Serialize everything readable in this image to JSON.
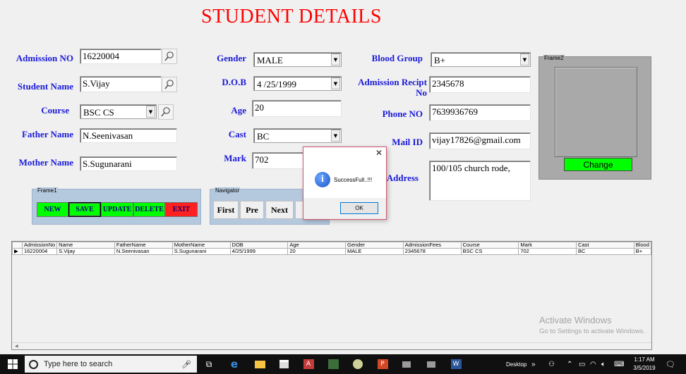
{
  "title": "STUDENT DETAILS",
  "labels": {
    "admission_no": "Admission NO",
    "student_name": "Student Name",
    "course": "Course",
    "father_name": "Father Name",
    "mother_name": "Mother Name",
    "gender": "Gender",
    "dob": "D.O.B",
    "age": "Age",
    "cast": "Cast",
    "mark": "Mark",
    "blood_group": "Blood Group",
    "admission_recipt_1": "Admission Recipt",
    "admission_recipt_2": "No",
    "phone_no": "Phone NO",
    "mail_id": "Mail ID",
    "address": "Address"
  },
  "values": {
    "admission_no": "16220004",
    "student_name": "S.Vijay",
    "course": "BSC CS",
    "father_name": "N.Seenivasan",
    "mother_name": "S.Sugunarani",
    "gender": "MALE",
    "dob": "4 /25/1999",
    "age": "20",
    "cast": "BC",
    "mark": "702",
    "blood_group": "B+",
    "admission_recipt": "2345678",
    "phone_no": "7639936769",
    "mail_id": "vijay17826@gmail.com",
    "address": "100/105 church rode,"
  },
  "frame1": {
    "title": "Frame1",
    "new": "NEW",
    "save": "SAVE",
    "update": "UPDATE",
    "delete": "DELETE",
    "exit": "EXIT"
  },
  "navigator": {
    "title": "Navigator",
    "first": "First",
    "pre": "Pre",
    "next": "Next"
  },
  "frame2": {
    "title": "Frame2",
    "change": "Change"
  },
  "grid": {
    "columns": [
      "AdmissionNo",
      "Name",
      "FatherName",
      "MotherName",
      "DOB",
      "Age",
      "Gender",
      "AdmissionFees",
      "Course",
      "Mark",
      "Cast",
      "Blood"
    ],
    "rows": [
      [
        "16220004",
        "S.Vijay",
        "N.Seenivasan",
        "S.Sugunarani",
        "4/25/1999",
        "20",
        "MALE",
        "2345678",
        "BSC CS",
        "702",
        "BC",
        "B+"
      ]
    ]
  },
  "dialog": {
    "message": "SuccessFull..!!!",
    "ok": "OK",
    "close": "✕"
  },
  "watermark": {
    "line1": "Activate Windows",
    "line2": "Go to Settings to activate Windows."
  },
  "taskbar": {
    "search_placeholder": "Type here to search",
    "desktop": "Desktop",
    "time": "1:17 AM",
    "date": "3/5/2019"
  },
  "colors": {
    "label_blue": "#1a1ad9",
    "title_red": "#ff0000",
    "button_green": "#00ff00",
    "button_red": "#ff2020",
    "frame_blue": "#b4c8de"
  }
}
